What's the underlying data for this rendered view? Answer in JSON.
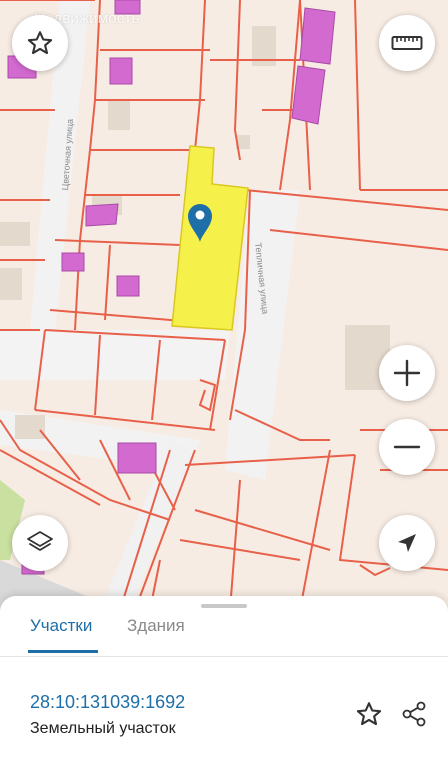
{
  "map": {
    "watermark": "Недвижимость",
    "streets": {
      "left": "Цветочная улица",
      "right": "Тепличная улица"
    },
    "colors": {
      "background": "#f7ece3",
      "parcel_border": "#e8604a",
      "building": "#d36ad0",
      "selected_parcel": "#f5f04a",
      "marker": "#1e6fa8"
    }
  },
  "controls": {
    "favorite_icon": "star-icon",
    "ruler_icon": "ruler-icon",
    "zoom_in_icon": "plus-icon",
    "zoom_out_icon": "minus-icon",
    "layers_icon": "layers-icon",
    "locate_icon": "navigation-arrow-icon"
  },
  "panel": {
    "tabs": [
      {
        "label": "Участки",
        "active": true
      },
      {
        "label": "Здания",
        "active": false
      }
    ],
    "result": {
      "cadastral_number": "28:10:131039:1692",
      "type": "Земельный участок"
    },
    "accent_color": "#1e6fa8"
  }
}
